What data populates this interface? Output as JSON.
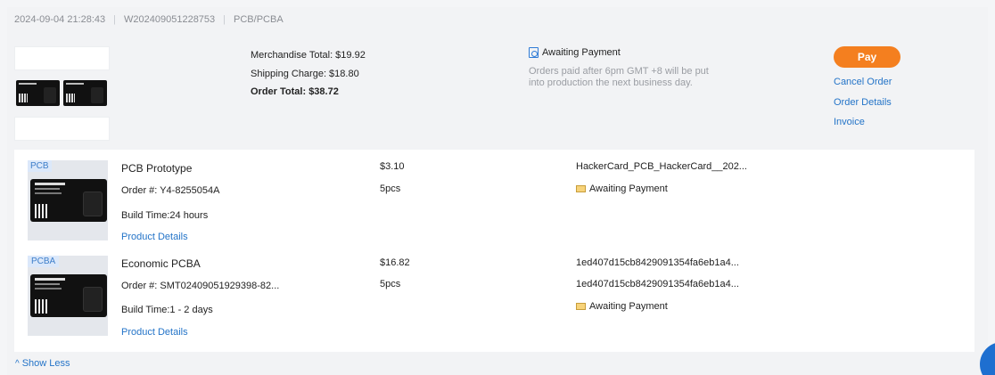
{
  "order": {
    "datetime": "2024-09-04 21:28:43",
    "order_no": "W202409051228753",
    "category": "PCB/PCBA"
  },
  "totals": {
    "merchandise": "Merchandise Total: $19.92",
    "shipping": "Shipping Charge: $18.80",
    "order_total": "Order Total: $38.72"
  },
  "status": {
    "label": "Awaiting Payment",
    "note": "Orders paid after 6pm GMT +8 will be put into production the next business day."
  },
  "actions": {
    "pay": "Pay",
    "cancel": "Cancel Order",
    "details": "Order Details",
    "invoice": "Invoice"
  },
  "items": [
    {
      "tag": "PCB",
      "name": "PCB Prototype",
      "order_no": "Order #: Y4-8255054A",
      "build_time": "Build Time:24 hours",
      "details_link": "Product Details",
      "price": "$3.10",
      "qty": "5pcs",
      "file": "HackerCard_PCB_HackerCard__202...",
      "status": "Awaiting Payment"
    },
    {
      "tag": "PCBA",
      "name": "Economic PCBA",
      "order_no": "Order #: SMT02409051929398-82...",
      "build_time": "Build Time:1 - 2 days",
      "details_link": "Product Details",
      "price": "$16.82",
      "qty": "5pcs",
      "file": "1ed407d15cb8429091354fa6eb1a4...",
      "file2": "1ed407d15cb8429091354fa6eb1a4...",
      "status": "Awaiting Payment"
    }
  ],
  "show_less": "Show Less",
  "colors": {
    "accent_orange": "#f47f1f",
    "link_blue": "#2474c8"
  },
  "icons": [
    "awaiting-payment-icon",
    "envelope-icon",
    "chevron-up-icon",
    "help-chat-icon"
  ]
}
